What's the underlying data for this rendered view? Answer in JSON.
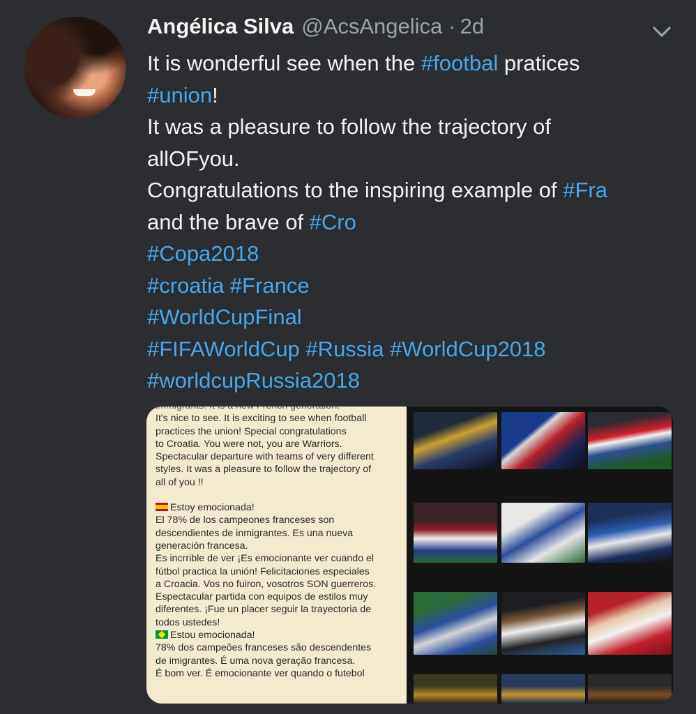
{
  "tweet": {
    "author_name": "Angélica Silva",
    "handle": "@AcsAngelica",
    "separator": "·",
    "time": "2d",
    "lines": [
      [
        {
          "t": "It is wonderful see when the "
        },
        {
          "t": "#footbal",
          "tag": true
        },
        {
          "t": " pratices"
        }
      ],
      [
        {
          "t": "#union",
          "tag": true
        },
        {
          "t": "!"
        }
      ],
      [
        {
          "t": "It was a pleasure to follow the trajectory of"
        }
      ],
      [
        {
          "t": "allOFyou."
        }
      ],
      [
        {
          "t": "Congratulations to the inspiring example of "
        },
        {
          "t": "#Fra",
          "tag": true
        }
      ],
      [
        {
          "t": "and the brave of "
        },
        {
          "t": "#Cro",
          "tag": true
        }
      ],
      [
        {
          "t": " "
        },
        {
          "t": "#Copa2018",
          "tag": true
        }
      ],
      [
        {
          "t": "#croatia",
          "tag": true
        },
        {
          "t": " "
        },
        {
          "t": "#France",
          "tag": true
        }
      ],
      [
        {
          "t": "#WorldCupFinal",
          "tag": true
        }
      ],
      [
        {
          "t": "#FIFAWorldCup",
          "tag": true
        },
        {
          "t": " "
        },
        {
          "t": "#Russia",
          "tag": true
        },
        {
          "t": " "
        },
        {
          "t": "#WorldCup2018",
          "tag": true
        }
      ],
      [
        {
          "t": "#worldcupRussia2018",
          "tag": true
        }
      ]
    ]
  },
  "media": {
    "doc_lines": [
      "immigrants. It is a new French generation.",
      "It's nice to see. It is exciting to see when football",
      "practices the union! Special congratulations",
      "to Croatia. You were not, you are Warriors.",
      "Spectacular departure with teams of very different",
      "styles. It was a pleasure to follow the trajectory of",
      "all of you !!",
      "",
      "Estoy emocionada!",
      "El 78% de los campeones franceses son",
      "descendientes de inmigrantes. Es una nueva",
      "generación francesa.",
      "Es incrrible de ver ¡Es emocionante ver cuando el",
      "fútbol practica la unión! Felicitaciones especiales",
      "a Croacia. Vos no fuiron,  vosotros SON guerreros.",
      "Espectacular partida con equipos de estilos muy",
      "diferentes. ¡Fue un placer seguir la trayectoria de",
      "todos ustedes!",
      "Estou emocionada!",
      "78% dos campeões franceses são descendentes",
      "de imigrantes. É uma nova geração francesa.",
      "É bom ver. É emocionante ver quando o futebol"
    ],
    "flag_es_line": 8,
    "flag_br_line": 18
  },
  "colors": {
    "background": "#2b2d30",
    "hashtag": "#4aa6e8",
    "secondary_text": "#9aa3ad",
    "primary_text": "#f2f2f2"
  },
  "icons": {
    "menu": "chevron-down-icon",
    "flag_es": "spain-flag-icon",
    "flag_br": "brazil-flag-icon"
  }
}
